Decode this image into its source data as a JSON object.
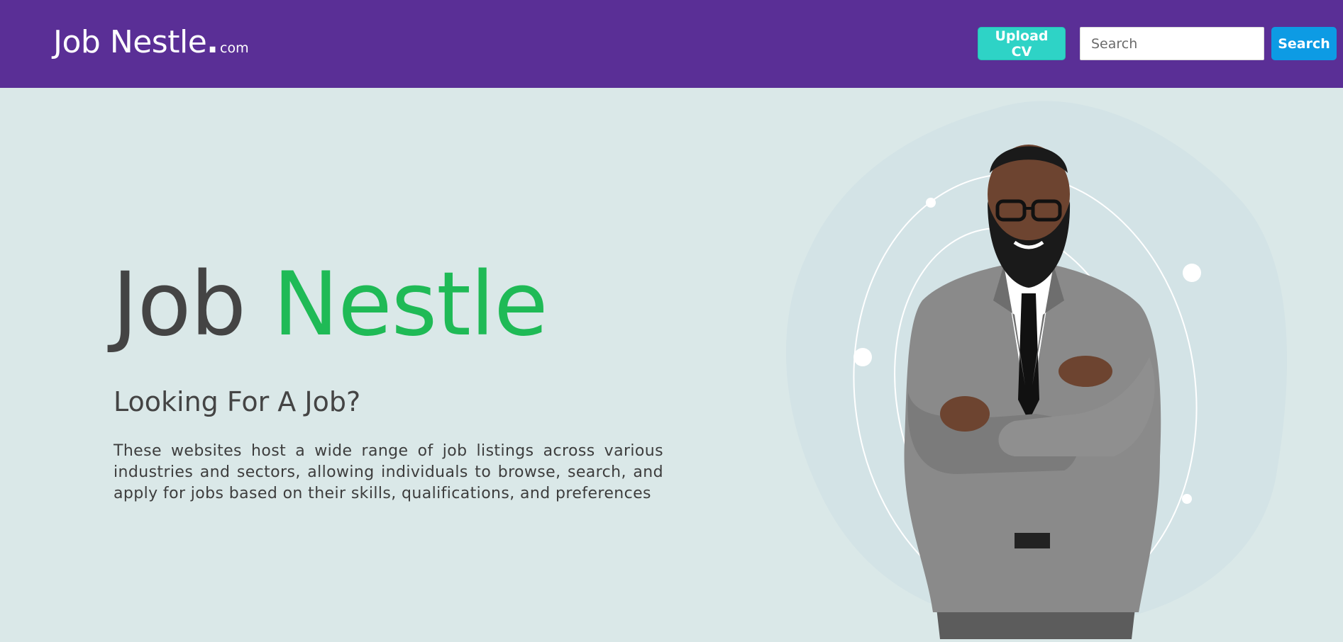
{
  "header": {
    "brand_main": "Job Nestle",
    "brand_dot": ".",
    "brand_tld": "com",
    "upload_label": "Upload CV",
    "search_placeholder": "Search",
    "search_value": "",
    "search_button_label": "Search"
  },
  "hero": {
    "title_part1": "Job",
    "title_part2": "Nestle",
    "subtitle": "Looking For A Job?",
    "description": "These websites host a wide range of job listings across various industries and sectors, allowing individuals to browse, search, and apply for jobs based on their skills, qualifications, and preferences"
  },
  "colors": {
    "header_bg": "#5a2f96",
    "page_bg": "#dae8e8",
    "upload_button": "#2ed3c6",
    "search_button": "#0d9be4",
    "title_accent": "#1fba56",
    "text_dark": "#444444"
  },
  "icons": {
    "hero_image": "businessman-illustration"
  }
}
